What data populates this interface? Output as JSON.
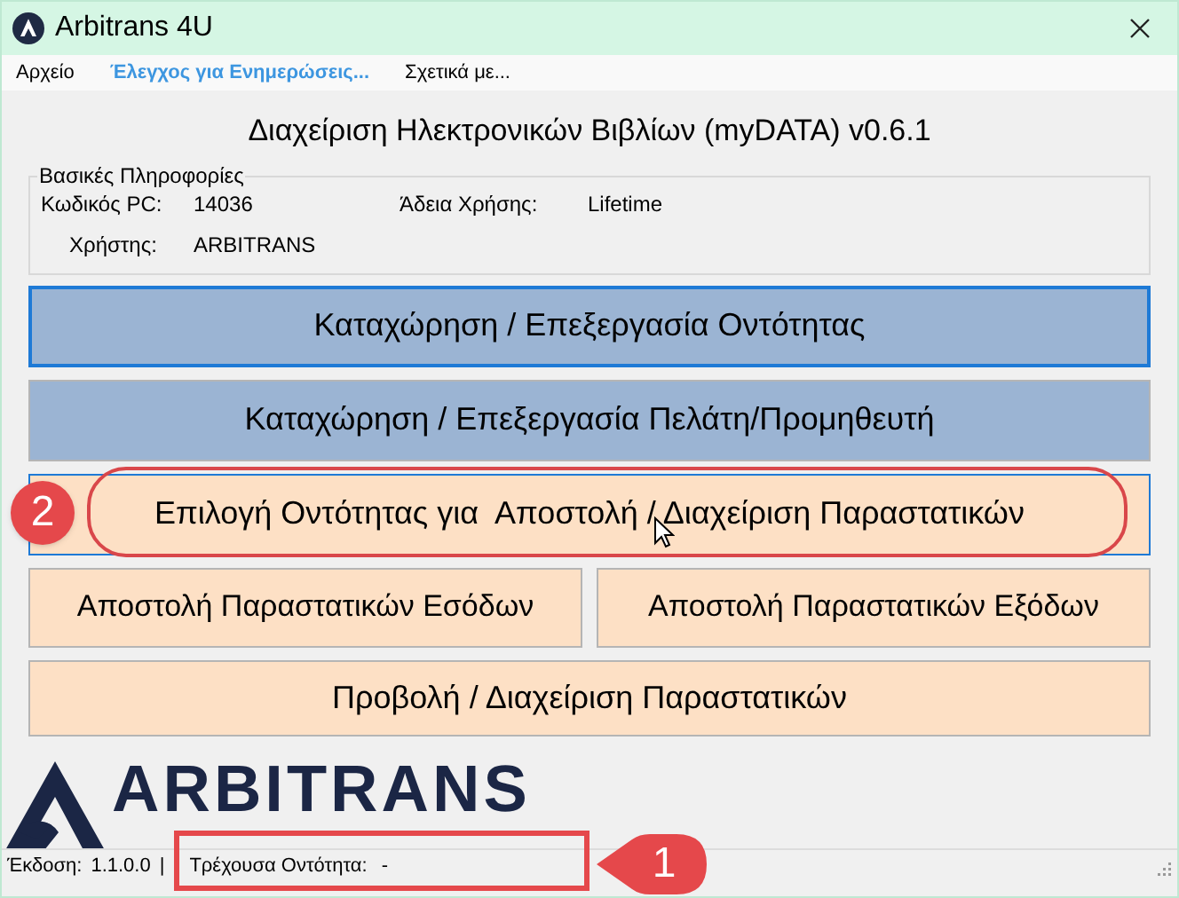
{
  "window": {
    "title": "Arbitrans 4U"
  },
  "menu": [
    {
      "label": "Αρχείο",
      "highlighted": false
    },
    {
      "label": "Έλεγχος για Ενημερώσεις...",
      "highlighted": true
    },
    {
      "label": "Σχετικά με...",
      "highlighted": false
    }
  ],
  "heading": "Διαχείριση Ηλεκτρονικών Βιβλίων (myDATA) v0.6.1",
  "info": {
    "title": "Βασικές Πληροφορίες",
    "pc_label": "Κωδικός PC:",
    "pc_value": "14036",
    "license_label": "Άδεια Χρήσης:",
    "license_value": "Lifetime",
    "user_label": "Χρήστης:",
    "user_value": "ARBITRANS"
  },
  "buttons": [
    [
      {
        "label": "Καταχώρηση / Επεξεργασία Οντότητας",
        "kind": "blue",
        "focused": true
      }
    ],
    [
      {
        "label": "Καταχώρηση / Επεξεργασία Πελάτη/Προμηθευτή",
        "kind": "blue",
        "focused": false
      }
    ],
    [
      {
        "label": "Επιλογή Οντότητας για  Αποστολή / Διαχείριση Παραστατικών",
        "kind": "peach",
        "focused": true
      }
    ],
    [
      {
        "label": "Αποστολή Παραστατικών Εσόδων",
        "kind": "peach",
        "focused": false
      },
      {
        "label": "Αποστολή Παραστατικών Εξόδων",
        "kind": "peach",
        "focused": false
      }
    ],
    [
      {
        "label": "Προβολή / Διαχείριση Παραστατικών",
        "kind": "peach",
        "focused": false
      }
    ]
  ],
  "logo": {
    "text": "ARBITRANS"
  },
  "status_bar": {
    "version_label": "Έκδοση:",
    "version": "1.1.0.0",
    "separator": "|",
    "entity_label": "Τρέχουσα Οντότητα:",
    "entity": "-"
  },
  "annotations": [
    {
      "label": "2"
    },
    {
      "label": "1"
    }
  ]
}
